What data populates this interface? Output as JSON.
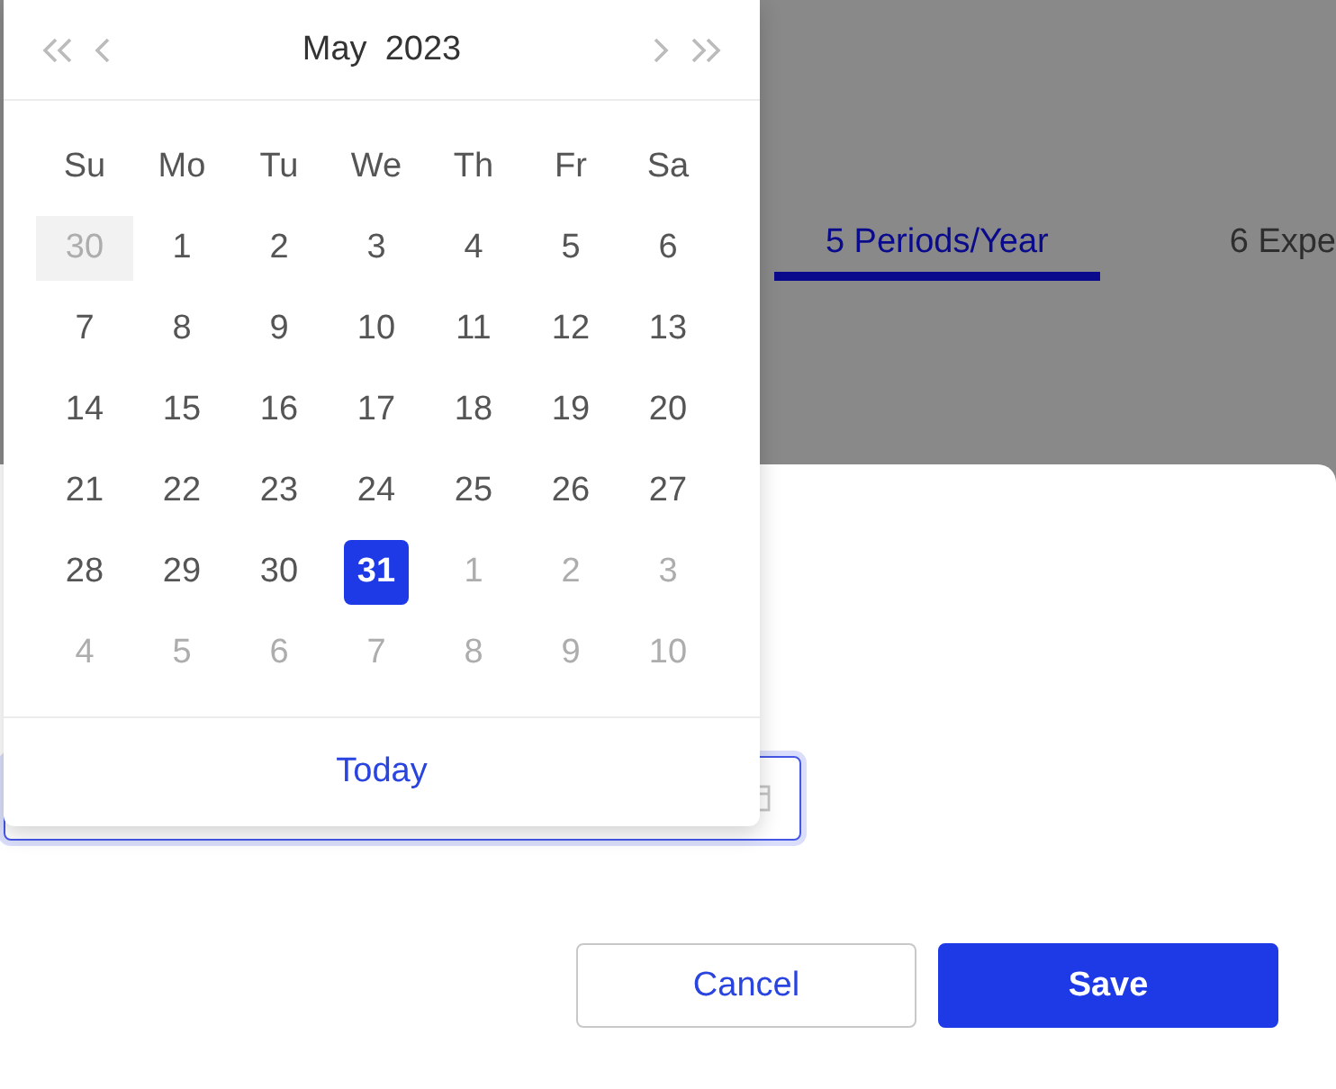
{
  "tabs": [
    {
      "label": "5 Periods/Year",
      "selected": true
    },
    {
      "label": "6 Expe",
      "selected": false
    }
  ],
  "date_picker": {
    "month": "May",
    "year": "2023",
    "weekdays": [
      "Su",
      "Mo",
      "Tu",
      "We",
      "Th",
      "Fr",
      "Sa"
    ],
    "days": [
      {
        "label": "30",
        "kind": "outside",
        "selected": false,
        "hovered": true
      },
      {
        "label": "1",
        "kind": "current",
        "selected": false,
        "hovered": false
      },
      {
        "label": "2",
        "kind": "current",
        "selected": false,
        "hovered": false
      },
      {
        "label": "3",
        "kind": "current",
        "selected": false,
        "hovered": false
      },
      {
        "label": "4",
        "kind": "current",
        "selected": false,
        "hovered": false
      },
      {
        "label": "5",
        "kind": "current",
        "selected": false,
        "hovered": false
      },
      {
        "label": "6",
        "kind": "current",
        "selected": false,
        "hovered": false
      },
      {
        "label": "7",
        "kind": "current",
        "selected": false,
        "hovered": false
      },
      {
        "label": "8",
        "kind": "current",
        "selected": false,
        "hovered": false
      },
      {
        "label": "9",
        "kind": "current",
        "selected": false,
        "hovered": false
      },
      {
        "label": "10",
        "kind": "current",
        "selected": false,
        "hovered": false
      },
      {
        "label": "11",
        "kind": "current",
        "selected": false,
        "hovered": false
      },
      {
        "label": "12",
        "kind": "current",
        "selected": false,
        "hovered": false
      },
      {
        "label": "13",
        "kind": "current",
        "selected": false,
        "hovered": false
      },
      {
        "label": "14",
        "kind": "current",
        "selected": false,
        "hovered": false
      },
      {
        "label": "15",
        "kind": "current",
        "selected": false,
        "hovered": false
      },
      {
        "label": "16",
        "kind": "current",
        "selected": false,
        "hovered": false
      },
      {
        "label": "17",
        "kind": "current",
        "selected": false,
        "hovered": false
      },
      {
        "label": "18",
        "kind": "current",
        "selected": false,
        "hovered": false
      },
      {
        "label": "19",
        "kind": "current",
        "selected": false,
        "hovered": false
      },
      {
        "label": "20",
        "kind": "current",
        "selected": false,
        "hovered": false
      },
      {
        "label": "21",
        "kind": "current",
        "selected": false,
        "hovered": false
      },
      {
        "label": "22",
        "kind": "current",
        "selected": false,
        "hovered": false
      },
      {
        "label": "23",
        "kind": "current",
        "selected": false,
        "hovered": false
      },
      {
        "label": "24",
        "kind": "current",
        "selected": false,
        "hovered": false
      },
      {
        "label": "25",
        "kind": "current",
        "selected": false,
        "hovered": false
      },
      {
        "label": "26",
        "kind": "current",
        "selected": false,
        "hovered": false
      },
      {
        "label": "27",
        "kind": "current",
        "selected": false,
        "hovered": false
      },
      {
        "label": "28",
        "kind": "current",
        "selected": false,
        "hovered": false
      },
      {
        "label": "29",
        "kind": "current",
        "selected": false,
        "hovered": false
      },
      {
        "label": "30",
        "kind": "current",
        "selected": false,
        "hovered": false
      },
      {
        "label": "31",
        "kind": "current",
        "selected": true,
        "hovered": false
      },
      {
        "label": "1",
        "kind": "outside",
        "selected": false,
        "hovered": false
      },
      {
        "label": "2",
        "kind": "outside",
        "selected": false,
        "hovered": false
      },
      {
        "label": "3",
        "kind": "outside",
        "selected": false,
        "hovered": false
      },
      {
        "label": "4",
        "kind": "outside",
        "selected": false,
        "hovered": false
      },
      {
        "label": "5",
        "kind": "outside",
        "selected": false,
        "hovered": false
      },
      {
        "label": "6",
        "kind": "outside",
        "selected": false,
        "hovered": false
      },
      {
        "label": "7",
        "kind": "outside",
        "selected": false,
        "hovered": false
      },
      {
        "label": "8",
        "kind": "outside",
        "selected": false,
        "hovered": false
      },
      {
        "label": "9",
        "kind": "outside",
        "selected": false,
        "hovered": false
      },
      {
        "label": "10",
        "kind": "outside",
        "selected": false,
        "hovered": false
      }
    ],
    "today_link": "Today"
  },
  "buttons": [
    {
      "label": "Cancel",
      "kind": "secondary"
    },
    {
      "label": "Save",
      "kind": "primary"
    }
  ]
}
